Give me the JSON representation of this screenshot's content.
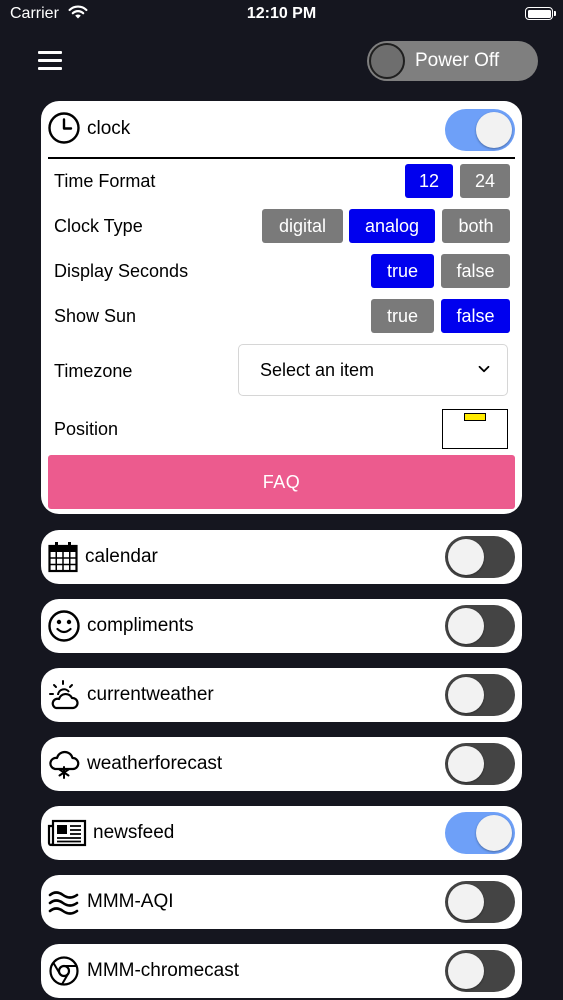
{
  "status_bar": {
    "carrier": "Carrier",
    "time": "12:10 PM"
  },
  "header": {
    "power_label": "Power Off",
    "power_on": false
  },
  "clock": {
    "name": "clock",
    "enabled": true,
    "settings": {
      "time_format": {
        "label": "Time Format",
        "options": [
          "12",
          "24"
        ],
        "selected": "12"
      },
      "clock_type": {
        "label": "Clock Type",
        "options": [
          "digital",
          "analog",
          "both"
        ],
        "selected": "analog"
      },
      "display_seconds": {
        "label": "Display Seconds",
        "options": [
          "true",
          "false"
        ],
        "selected": "true"
      },
      "show_sun": {
        "label": "Show Sun",
        "options": [
          "true",
          "false"
        ],
        "selected": "false"
      },
      "timezone": {
        "label": "Timezone",
        "placeholder": "Select an item"
      },
      "position": {
        "label": "Position"
      }
    },
    "faq_label": "FAQ"
  },
  "modules": [
    {
      "name": "calendar",
      "icon": "calendar-icon",
      "enabled": false
    },
    {
      "name": "compliments",
      "icon": "smiley-icon",
      "enabled": false
    },
    {
      "name": "currentweather",
      "icon": "sun-cloud-icon",
      "enabled": false
    },
    {
      "name": "weatherforecast",
      "icon": "snow-cloud-icon",
      "enabled": false
    },
    {
      "name": "newsfeed",
      "icon": "newspaper-icon",
      "enabled": true
    },
    {
      "name": "MMM-AQI",
      "icon": "waves-icon",
      "enabled": false
    },
    {
      "name": "MMM-chromecast",
      "icon": "chrome-icon",
      "enabled": false
    }
  ],
  "colors": {
    "background": "#15161f",
    "selected_chip": "#0000ee",
    "unselected_chip": "#7a7a7a",
    "switch_on": "#6ea0f8",
    "switch_off": "#444444",
    "faq_button": "#ec5b8e",
    "position_marker": "#ffeb00"
  }
}
